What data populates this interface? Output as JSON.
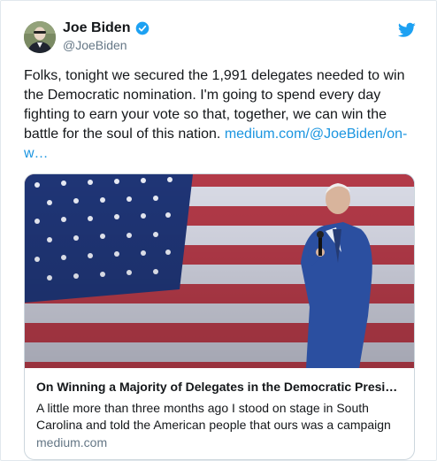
{
  "author": {
    "display_name": "Joe Biden",
    "handle": "@JoeBiden",
    "avatar_icon": "profile-avatar",
    "verified_icon": "verified-badge-icon"
  },
  "tweet": {
    "text_main": "Folks, tonight we secured the 1,991 delegates needed to win the Democratic nomination. I'm going to spend every day fighting to earn your vote so that, together, we can win the battle for the soul of this nation. ",
    "link_text": "medium.com/@JoeBiden/on-w…"
  },
  "card": {
    "title": "On Winning a Majority of Delegates in the Democratic Presi…",
    "description": "A little more than three months ago I stood on stage in South Carolina and told the American people that ours was a campaign",
    "domain": "medium.com"
  },
  "icons": {
    "brand": "twitter-bird-icon"
  },
  "colors": {
    "link": "#1b95e0",
    "secondary_text": "#657786",
    "border": "#ccd6dd",
    "brand": "#1da1f2"
  }
}
